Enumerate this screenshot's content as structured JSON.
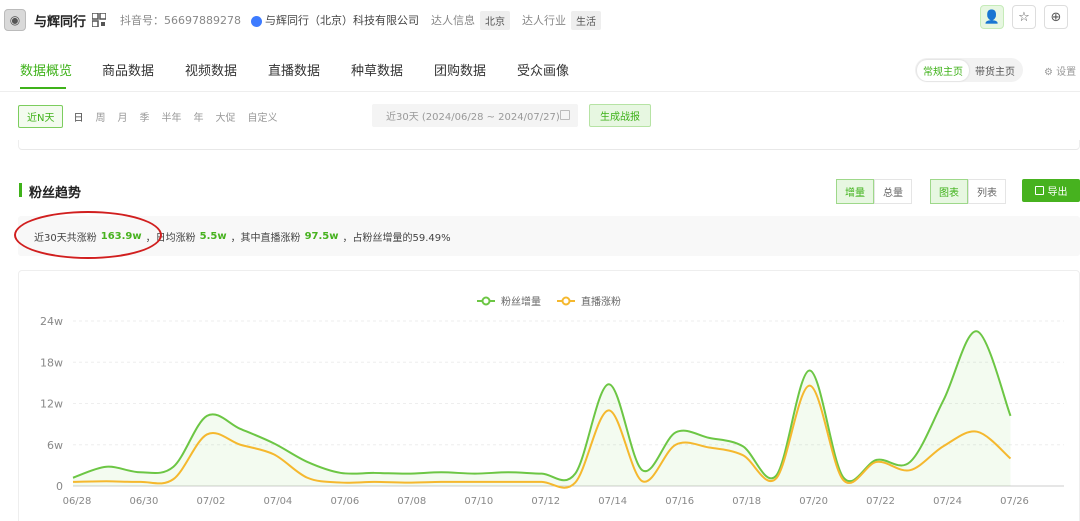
{
  "header": {
    "name": "与辉同行",
    "douyin_id": "抖音号：56697889278",
    "company": "与辉同行（北京）科技有限公司",
    "info_label": "达人信息",
    "info_chip": "北京",
    "industry_label": "达人行业",
    "industry_chip": "生活"
  },
  "tabs": [
    "数据概览",
    "商品数据",
    "视频数据",
    "直播数据",
    "种草数据",
    "团购数据",
    "受众画像"
  ],
  "home_switch": {
    "items": [
      "常规主页",
      "带货主页"
    ],
    "active": 0
  },
  "settings_label": "设置",
  "filters": {
    "periods": [
      "近N天",
      "日",
      "周",
      "月",
      "季",
      "半年",
      "年",
      "大促",
      "自定义"
    ],
    "date_range": "近30天 (2024/06/28 ~ 2024/07/27)",
    "report_button": "生成战报"
  },
  "section": {
    "title": "粉丝趋势",
    "mode_toggle": [
      "增量",
      "总量"
    ],
    "view_toggle": [
      "图表",
      "列表"
    ],
    "export_label": "导出"
  },
  "summary": {
    "prefix": "近30天共涨粉",
    "total": "163.9w",
    "sep1": "，",
    "avg_label": "日均涨粉",
    "avg": "5.5w",
    "mid": "，其中直播涨粉",
    "live": "97.5w",
    "suffix": "，占粉丝增量的59.49%"
  },
  "colors": {
    "accent": "#3fb21a",
    "series_fans": "#6cc644",
    "series_live": "#f5b82e",
    "annotation": "#d11f1f"
  },
  "chart_data": {
    "type": "area",
    "x": [
      "06/28",
      "06/29",
      "06/30",
      "07/01",
      "07/02",
      "07/03",
      "07/04",
      "07/05",
      "07/06",
      "07/07",
      "07/08",
      "07/09",
      "07/10",
      "07/11",
      "07/12",
      "07/13",
      "07/14",
      "07/15",
      "07/16",
      "07/17",
      "07/18",
      "07/19",
      "07/20",
      "07/21",
      "07/22",
      "07/23",
      "07/24",
      "07/25",
      "07/26",
      "07/27"
    ],
    "x_tick_labels": [
      "06/28",
      "06/30",
      "07/02",
      "07/04",
      "07/06",
      "07/08",
      "07/10",
      "07/12",
      "07/14",
      "07/16",
      "07/18",
      "07/20",
      "07/22",
      "07/24",
      "07/26"
    ],
    "y_ticks": [
      "0",
      "6w",
      "12w",
      "18w",
      "24w"
    ],
    "ylim": [
      0,
      24
    ],
    "series": [
      {
        "name": "粉丝增量",
        "values": [
          1.2,
          2.8,
          2.0,
          2.8,
          10.2,
          8.3,
          6.2,
          3.5,
          1.9,
          1.9,
          1.8,
          2.0,
          1.8,
          2.0,
          1.8,
          1.8,
          14.8,
          2.3,
          7.8,
          7.0,
          5.8,
          1.5,
          16.8,
          1.3,
          3.8,
          3.5,
          12.5,
          22.5,
          10.2,
          0
        ]
      },
      {
        "name": "直播涨粉",
        "values": [
          0.6,
          0.7,
          0.6,
          1.0,
          7.5,
          6.0,
          4.6,
          1.2,
          0.5,
          0.6,
          0.5,
          0.6,
          0.6,
          0.6,
          0.6,
          0.5,
          11.0,
          0.7,
          6.0,
          5.6,
          4.5,
          1.1,
          14.6,
          0.9,
          3.5,
          2.3,
          5.8,
          7.9,
          4.0,
          0
        ]
      }
    ],
    "legend_position": "top-center",
    "grid": true
  }
}
